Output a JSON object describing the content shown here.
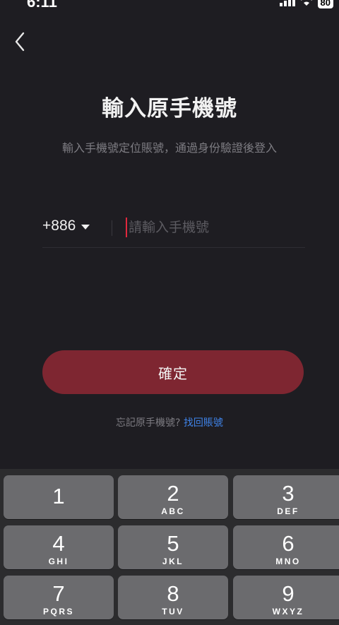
{
  "status_bar": {
    "time": "6:11",
    "battery": "80",
    "icons": [
      "signal-icon",
      "wifi-icon",
      "battery-icon"
    ]
  },
  "header": {
    "back_icon": "chevron-left-icon",
    "title": "輸入原手機號",
    "subtitle": "輸入手機號定位賬號，通過身份驗證後登入"
  },
  "phone": {
    "country_code": "+886",
    "dropdown_icon": "caret-down-icon",
    "placeholder": "請輸入手機號",
    "value": ""
  },
  "confirm_button": {
    "label": "確定"
  },
  "forgot": {
    "text": "忘記原手機號?",
    "link": "找回賬號"
  },
  "colors": {
    "background": "#1e1d22",
    "accent": "#7e2631",
    "caret": "#e0283d",
    "link": "#3f83e8",
    "muted_text": "#7d7c82"
  },
  "keyboard": {
    "keys": [
      {
        "num": "1",
        "letters": ""
      },
      {
        "num": "2",
        "letters": "ABC"
      },
      {
        "num": "3",
        "letters": "DEF"
      },
      {
        "num": "4",
        "letters": "GHI"
      },
      {
        "num": "5",
        "letters": "JKL"
      },
      {
        "num": "6",
        "letters": "MNO"
      },
      {
        "num": "7",
        "letters": "PQRS"
      },
      {
        "num": "8",
        "letters": "TUV"
      },
      {
        "num": "9",
        "letters": "WXYZ"
      }
    ]
  }
}
